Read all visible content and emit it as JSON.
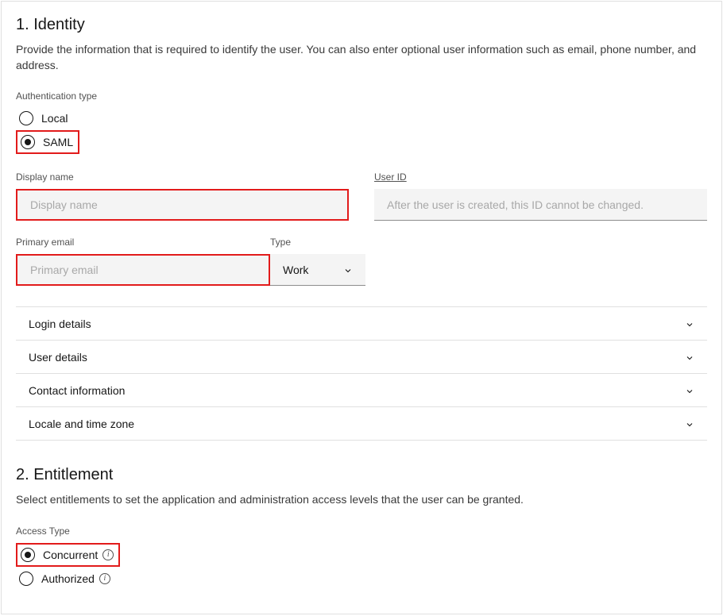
{
  "identity": {
    "title": "1. Identity",
    "description": "Provide the information that is required to identify the user. You can also enter optional user information such as email, phone number, and address.",
    "authType": {
      "label": "Authentication type",
      "options": [
        "Local",
        "SAML"
      ],
      "selected": "SAML"
    },
    "displayName": {
      "label": "Display name",
      "placeholder": "Display name",
      "value": ""
    },
    "userId": {
      "label": "User ID",
      "placeholder": "After the user is created, this ID cannot be changed.",
      "value": ""
    },
    "primaryEmail": {
      "label": "Primary email",
      "placeholder": "Primary email",
      "value": ""
    },
    "emailType": {
      "label": "Type",
      "selected": "Work"
    },
    "accordion": [
      "Login details",
      "User details",
      "Contact information",
      "Locale and time zone"
    ]
  },
  "entitlement": {
    "title": "2. Entitlement",
    "description": "Select entitlements to set the application and administration access levels that the user can be granted.",
    "accessType": {
      "label": "Access Type",
      "options": [
        "Concurrent",
        "Authorized"
      ],
      "selected": "Concurrent"
    }
  }
}
